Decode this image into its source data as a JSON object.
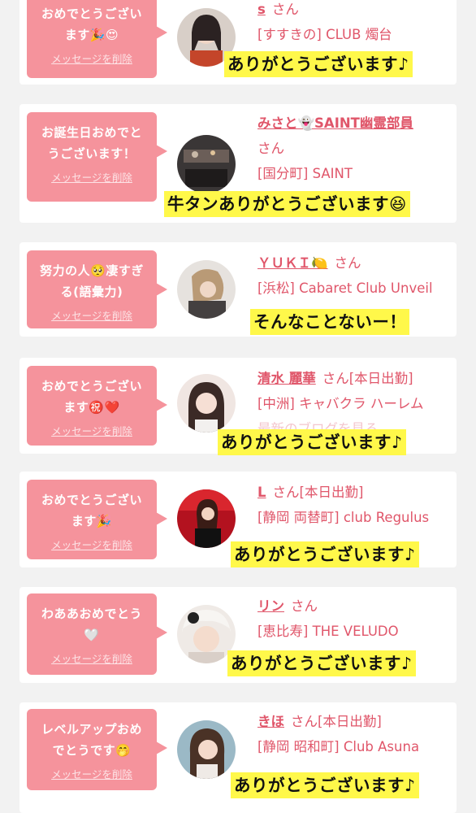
{
  "colors": {
    "bubble": "#f5939c",
    "accent_text": "#e0566a",
    "highlight": "#fff84a",
    "background": "#f2f2f2"
  },
  "delete_label": "メッセージを削除",
  "messages": [
    {
      "bubble_text": "おめでとうござい\nます🎉😍",
      "name": "s",
      "suffix": "さん",
      "line1": "[すすきの] CLUB 燭台",
      "line2": "",
      "reply": "ありがとうございます♪"
    },
    {
      "bubble_text": "お誕生日おめでと\nうございます！",
      "name": "みさと👻SAINT幽霊部員",
      "suffix": "さん",
      "line1": "[国分町] SAINT",
      "line2": "",
      "reply": "牛タンありがとうございます😆"
    },
    {
      "bubble_text": "努力の人🥺凄すぎ\nる(語彙力)",
      "name": "ＹＵＫＩ🍋",
      "suffix": "さん",
      "line1": "[浜松] Cabaret Club Unveil",
      "line2": "",
      "reply": "そんなことないー！"
    },
    {
      "bubble_text": "おめでとうござい\nます㊗️❤️",
      "name": "清水 麗華",
      "suffix": "さん[本日出勤]",
      "line1": "[中洲] キャバクラ ハーレム",
      "line2": "最新のブログを見る",
      "reply": "ありがとうございます♪"
    },
    {
      "bubble_text": "おめでとうござい\nます🎉",
      "name": "L",
      "suffix": "さん[本日出勤]",
      "line1": "[静岡 両替町] club Regulus",
      "line2": "",
      "reply": "ありがとうございます♪"
    },
    {
      "bubble_text": "わああおめでとう\n🤍",
      "name": "リン",
      "suffix": "さん",
      "line1": "[恵比寿] THE VELUDO",
      "line2": "",
      "reply": "ありがとうございます♪"
    },
    {
      "bubble_text": "レベルアップおめ\nでとうです🤭",
      "name": "きほ",
      "suffix": "さん[本日出勤]",
      "line1": "[静岡 昭和町] Club Asuna",
      "line2": "",
      "reply": "ありがとうございます♪"
    }
  ]
}
